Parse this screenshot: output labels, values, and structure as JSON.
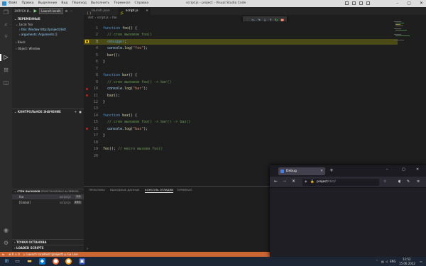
{
  "titlebar": {
    "menu": [
      "Файл",
      "Правка",
      "Выделение",
      "Вид",
      "Переход",
      "Выполнить",
      "Терминал",
      "Справка"
    ],
    "title": "script.js - project - Visual Studio Code"
  },
  "runbar": {
    "label": "ЗАПУСК И...",
    "config": "Launch localh"
  },
  "sidebar": {
    "variables_header": "ПЕРЕМЕННЫЕ",
    "scopes": [
      {
        "label": "Local: foo",
        "arrow": "⌄"
      },
      {
        "label": "this: Window http://project/dist/",
        "arrow": "›"
      },
      {
        "label": "arguments: Arguments []",
        "arrow": "›"
      },
      {
        "label": "Block",
        "arrow": "›"
      },
      {
        "label": "Object: Window",
        "arrow": "›"
      }
    ],
    "watch_header": "КОНТРОЛЬНОЕ ЗНАЧЕНИЕ",
    "callstack_header": "СТЕК ВЫЗОВОВ",
    "callstack_status": "ПРИОСТАНОВЛЕНО НА DEBUGG...",
    "frames": [
      {
        "name": "foo",
        "file": "script.js",
        "line": "3:3"
      },
      {
        "name": "[Global]",
        "file": "script.js",
        "line": "19:1"
      }
    ],
    "breakpoints_header": "ТОЧКИ ОСТАНОВА",
    "loaded_header": "LOADED SCRIPTS"
  },
  "tabs": [
    {
      "label": "launch.json",
      "icon": "{ }"
    },
    {
      "label": "script.js",
      "icon": "JS",
      "close": "×"
    }
  ],
  "breadcrumbs": [
    "dist",
    "script.js",
    "foo"
  ],
  "code_lines": [
    {
      "n": "1",
      "html": "<span class=\"kw\">function</span> <span class=\"fn\">foo</span>() {"
    },
    {
      "n": "2",
      "html": "  <span class=\"cm\">// стек вызовов foo()</span>"
    },
    {
      "n": "3",
      "html": "  <span class=\"kw\">debugger</span>;",
      "current": true
    },
    {
      "n": "4",
      "html": "  <span class=\"var\">console</span>.<span class=\"fn\">log</span>(<span class=\"str\">\"foo\"</span>);"
    },
    {
      "n": "5",
      "html": "  <span class=\"fn\">bar</span>();"
    },
    {
      "n": "6",
      "html": "}"
    },
    {
      "n": "7",
      "html": ""
    },
    {
      "n": "8",
      "html": "<span class=\"kw\">function</span> <span class=\"fn\">bar</span>() {"
    },
    {
      "n": "9",
      "html": "  <span class=\"cm\">// стек вызовов foo() -&gt; bar()</span>"
    },
    {
      "n": "10",
      "html": "  <span class=\"var\">console</span>.<span class=\"fn\">log</span>(<span class=\"str\">\"bar\"</span>);",
      "bp": true
    },
    {
      "n": "11",
      "html": "  <span class=\"fn\">baz</span>();",
      "bp": true
    },
    {
      "n": "12",
      "html": "}"
    },
    {
      "n": "13",
      "html": ""
    },
    {
      "n": "14",
      "html": "<span class=\"kw\">function</span> <span class=\"fn\">baz</span>() {"
    },
    {
      "n": "15",
      "html": "  <span class=\"cm\">// стек вызовов foo() -&gt; bar() -&gt; baz()</span>"
    },
    {
      "n": "16",
      "html": "  <span class=\"var\">console</span>.<span class=\"fn\">log</span>(<span class=\"str\">\"baz\"</span>);",
      "bp": true
    },
    {
      "n": "17",
      "html": "}"
    },
    {
      "n": "18",
      "html": ""
    },
    {
      "n": "19",
      "html": "<span class=\"fn\">foo</span>(); <span class=\"cm\">// место вызова foo()</span>"
    },
    {
      "n": "20",
      "html": ""
    }
  ],
  "panel": {
    "tabs": [
      "ПРОБЛЕМЫ",
      "ВЫХОДНЫЕ ДАННЫЕ",
      "КОНСОЛЬ ОТЛАДКИ",
      "ТЕРМИНАЛ"
    ],
    "active": 2,
    "prompt": "›"
  },
  "statusbar": {
    "errors": "⊗ 0 ⚠ 0",
    "launch": "▷ Launch localhost (project)",
    "liveserver": "◎ Go Live"
  },
  "browser": {
    "tab_title": "Debug",
    "url_host": "project",
    "url_path": "/dist/",
    "new_tab": "+"
  },
  "taskbar": {
    "lang": "ENG",
    "time": "12:52",
    "date": "15.06.2022"
  }
}
